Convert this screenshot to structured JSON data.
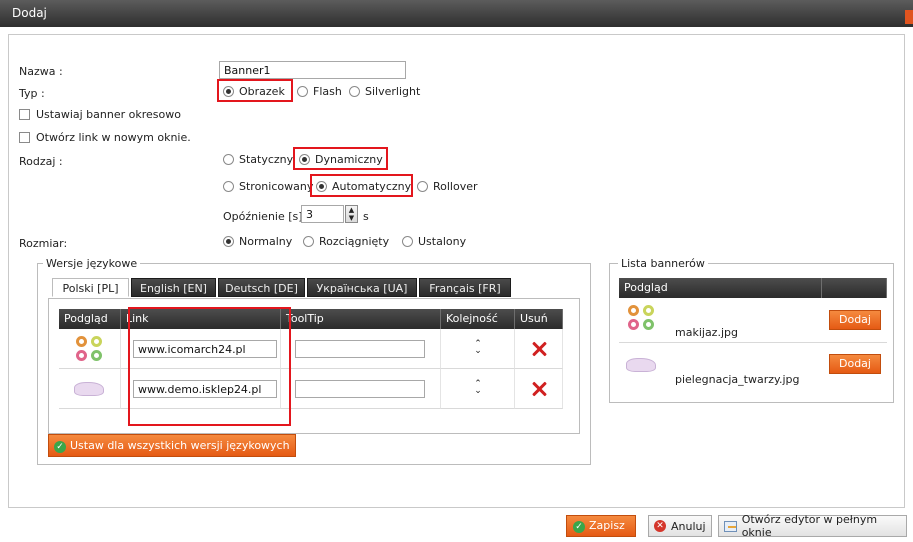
{
  "window": {
    "title": "Dodaj"
  },
  "form": {
    "name_label": "Nazwa :",
    "name_value": "Banner1",
    "type_label": "Typ :",
    "type_options": [
      "Obrazek",
      "Flash",
      "Silverlight"
    ],
    "type_selected": "Obrazek",
    "periodic_label": "Ustawiaj banner okresowo",
    "new_window_label": "Otwórz link w nowym oknie.",
    "kind_label": "Rodzaj :",
    "kind_row1": [
      "Statyczny",
      "Dynamiczny"
    ],
    "kind_row2": [
      "Stronicowany",
      "Automatyczny",
      "Rollover"
    ],
    "kind_selected": "Dynamiczny",
    "kind2_selected": "Automatyczny",
    "delay_label": "Opóźnienie [s]:",
    "delay_value": "3",
    "delay_unit": "s",
    "size_label": "Rozmiar:",
    "size_options": [
      "Normalny",
      "Rozciągnięty",
      "Ustalony"
    ],
    "size_selected": "Normalny"
  },
  "languages": {
    "legend": "Wersje językowe",
    "tabs": [
      "Polski [PL]",
      "English [EN]",
      "Deutsch [DE]",
      "Українська [UA]",
      "Français [FR]"
    ],
    "active_tab": "Polski [PL]",
    "columns": [
      "Podgląd",
      "Link",
      "ToolTip",
      "Kolejność",
      "Usuń"
    ],
    "rows": [
      {
        "preview_icon": "makeup-rings-icon",
        "link": "www.icomarch24.pl",
        "tooltip": ""
      },
      {
        "preview_icon": "cloth-icon",
        "link": "www.demo.isklep24.pl",
        "tooltip": ""
      }
    ],
    "apply_all_button": "Ustaw dla wszystkich wersji językowych"
  },
  "banner_list": {
    "legend": "Lista bannerów",
    "column": "Podgląd",
    "items": [
      {
        "preview_icon": "makeup-rings-icon",
        "name": "makijaz.jpg",
        "button": "Dodaj"
      },
      {
        "preview_icon": "cloth-icon",
        "name": "pielegnacja_twarzy.jpg",
        "button": "Dodaj"
      }
    ]
  },
  "footer": {
    "save": "Zapisz",
    "cancel": "Anuluj",
    "editor": "Otwórz edytor w pełnym oknie"
  },
  "colors": {
    "accent": "#e55a14",
    "highlight": "#e3161d",
    "header": "#2b2b2b"
  }
}
